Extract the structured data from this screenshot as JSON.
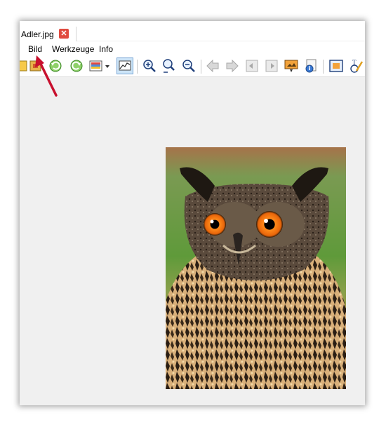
{
  "tab": {
    "title": "Adler.jpg",
    "close_glyph": "✕"
  },
  "menu": {
    "items": [
      "Bild",
      "Werkzeuge",
      "Info"
    ]
  },
  "toolbar": {
    "icons": [
      "image-icon",
      "crop-icon",
      "rotate-left-icon",
      "rotate-right-icon",
      "color-palette-icon",
      "dropdown-arrow-icon",
      "histogram-icon",
      "zoom-in-icon",
      "zoom-fit-icon",
      "zoom-out-icon",
      "previous-arrow-icon",
      "next-arrow-icon",
      "previous-page-icon",
      "next-page-icon",
      "slideshow-icon",
      "image-info-icon",
      "fit-window-icon",
      "text-draw-icon"
    ]
  },
  "colors": {
    "annotation_arrow": "#c8102e",
    "close_button": "#e04a3f",
    "histogram_active": "#cce4f7"
  }
}
